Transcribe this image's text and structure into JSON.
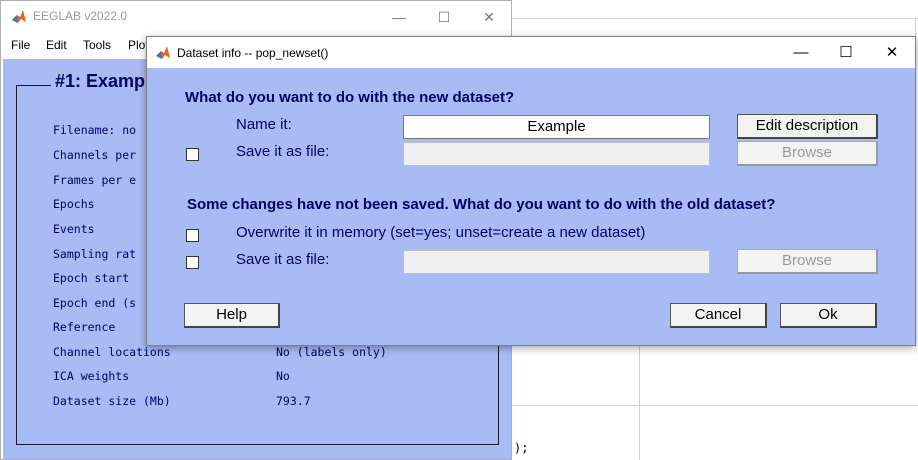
{
  "eeglab": {
    "title": "EEGLAB v2022.0",
    "menus": [
      "File",
      "Edit",
      "Tools",
      "Plot"
    ],
    "dataset_title": "#1: Examp",
    "info": [
      {
        "label": "Filename: no",
        "value": ""
      },
      {
        "label": "Channels per",
        "value": ""
      },
      {
        "label": "Frames per e",
        "value": ""
      },
      {
        "label": "Epochs",
        "value": ""
      },
      {
        "label": "Events",
        "value": ""
      },
      {
        "label": "Sampling rat",
        "value": ""
      },
      {
        "label": "Epoch start",
        "value": ""
      },
      {
        "label": "Epoch end (s",
        "value": ""
      },
      {
        "label": "Reference",
        "value": ""
      },
      {
        "label": "Channel locations",
        "value": "No (labels only)"
      },
      {
        "label": "ICA weights",
        "value": "No"
      },
      {
        "label": "Dataset size (Mb)",
        "value": "793.7"
      }
    ],
    "controls": {
      "minimize": "—",
      "maximize": "☐",
      "close": "✕"
    }
  },
  "background": {
    "cmd_text": ");"
  },
  "dialog": {
    "title": "Dataset info -- pop_newset()",
    "controls": {
      "minimize": "—",
      "maximize": "☐",
      "close": "✕"
    },
    "new_heading": "What do you want to do with the new dataset?",
    "name_label": "Name it:",
    "name_value": "Example",
    "edit_description": "Edit description",
    "save_new_label": "Save it as file:",
    "browse_label": "Browse",
    "old_heading": "Some changes have not been saved. What do you want to do with the old dataset?",
    "overwrite_label": "Overwrite it in memory (set=yes; unset=create a new dataset)",
    "save_old_label": "Save it as file:",
    "help_label": "Help",
    "cancel_label": "Cancel",
    "ok_label": "Ok"
  }
}
